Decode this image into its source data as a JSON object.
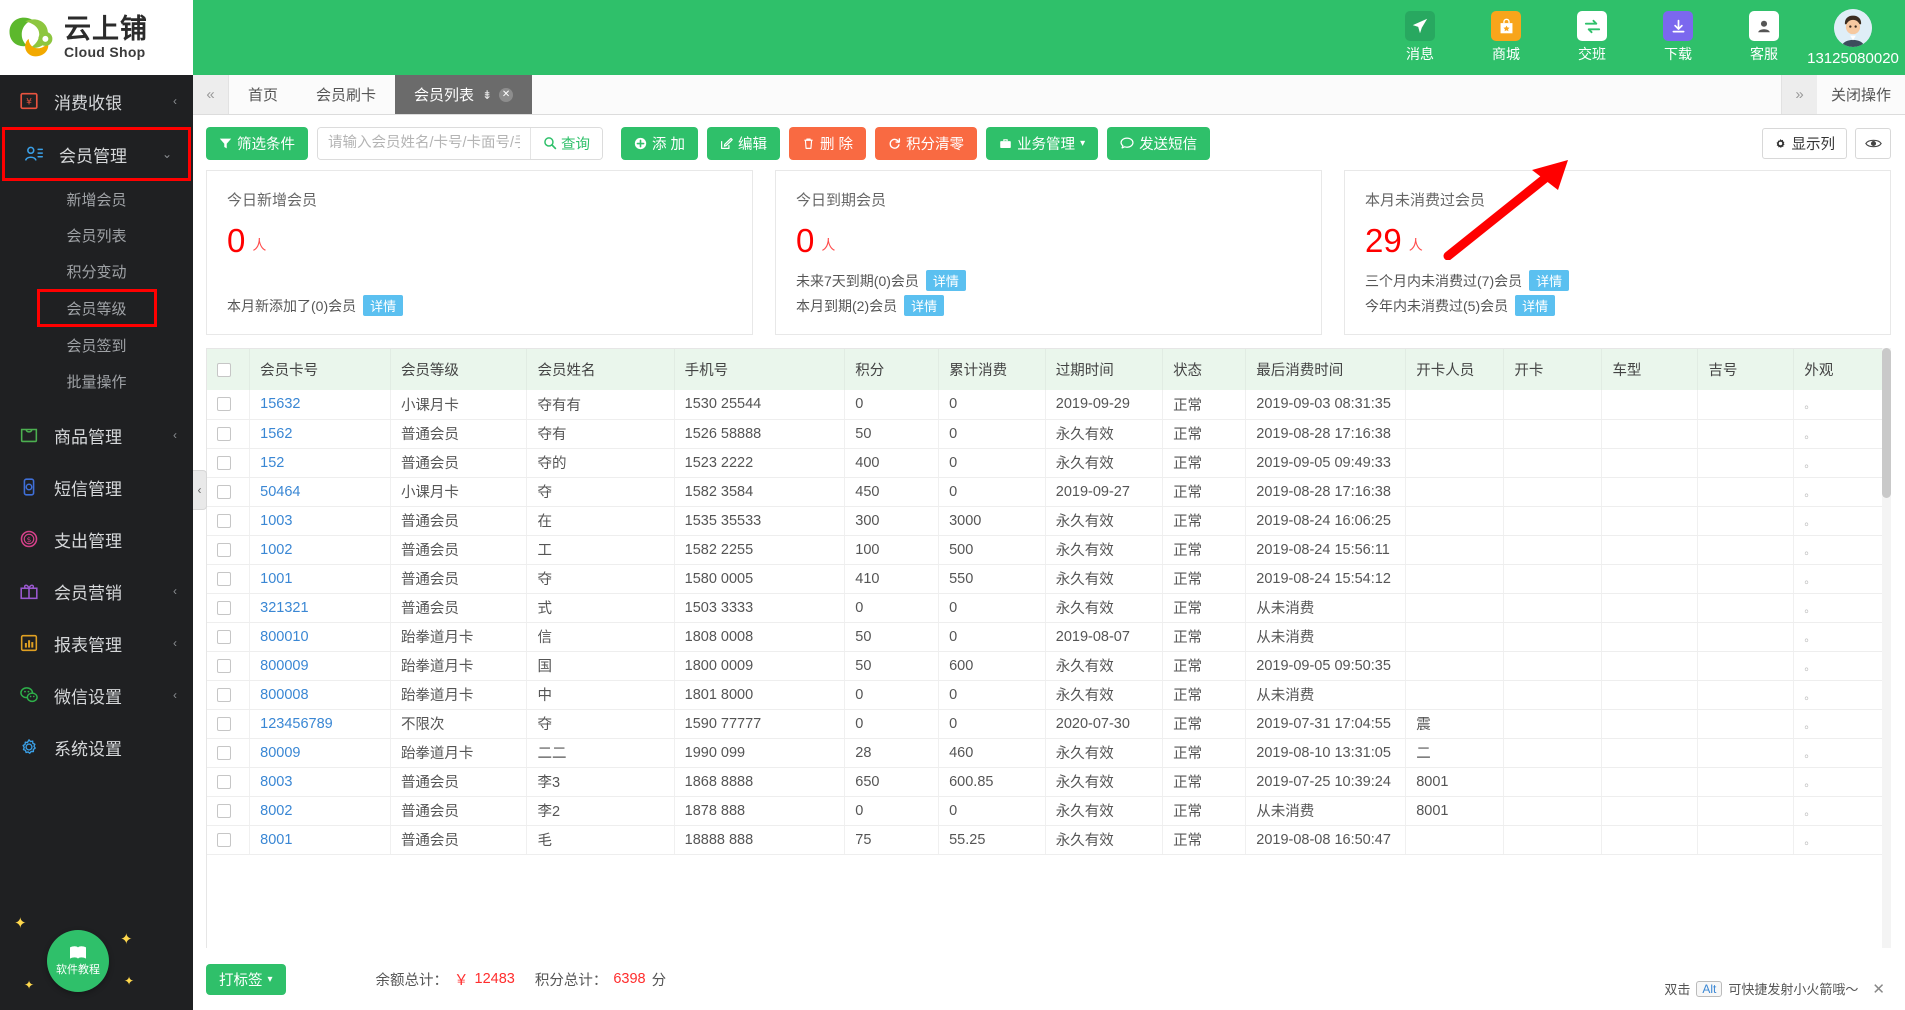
{
  "brand": {
    "cn": "云上铺",
    "en": "Cloud Shop"
  },
  "header": {
    "items": [
      {
        "label": "消息",
        "icon": "paper-plane-icon"
      },
      {
        "label": "商城",
        "icon": "shop-bag-icon"
      },
      {
        "label": "交班",
        "icon": "shift-exchange-icon"
      },
      {
        "label": "下载",
        "icon": "download-icon"
      },
      {
        "label": "客服",
        "icon": "customer-service-icon"
      }
    ],
    "account": "13125080020",
    "accent": "#2fc06a"
  },
  "sidebar": {
    "items": [
      {
        "label": "消费收银",
        "icon": "cashier-icon",
        "arrow": "‹",
        "boxed": false
      },
      {
        "label": "会员管理",
        "icon": "member-icon",
        "arrow": "⌄",
        "boxed": true
      }
    ],
    "sub_items": [
      {
        "label": "新增会员",
        "boxed": false
      },
      {
        "label": "会员列表",
        "boxed": false
      },
      {
        "label": "积分变动",
        "boxed": false
      },
      {
        "label": "会员等级",
        "boxed": true
      },
      {
        "label": "会员签到",
        "boxed": false
      },
      {
        "label": "批量操作",
        "boxed": false
      }
    ],
    "items_bottom": [
      {
        "label": "商品管理",
        "icon": "goods-icon",
        "arrow": "‹"
      },
      {
        "label": "短信管理",
        "icon": "sms-icon",
        "arrow": ""
      },
      {
        "label": "支出管理",
        "icon": "expense-icon",
        "arrow": ""
      },
      {
        "label": "会员营销",
        "icon": "gift-icon",
        "arrow": "‹"
      },
      {
        "label": "报表管理",
        "icon": "report-icon",
        "arrow": "‹"
      },
      {
        "label": "微信设置",
        "icon": "wechat-icon",
        "arrow": "‹"
      },
      {
        "label": "系统设置",
        "icon": "gear-icon",
        "arrow": ""
      }
    ]
  },
  "tabs": {
    "prev_icon": "«",
    "next_icon": "»",
    "items": [
      {
        "label": "首页",
        "active": false,
        "closable": false
      },
      {
        "label": "会员刷卡",
        "active": false,
        "closable": false
      },
      {
        "label": "会员列表",
        "active": true,
        "closable": true
      }
    ],
    "close_all": "关闭操作"
  },
  "toolbar": {
    "filter_label": "筛选条件",
    "search_placeholder": "请输入会员姓名/卡号/卡面号/手机号",
    "search_value": "",
    "query_label": "查询",
    "buttons": [
      {
        "label": "添 加",
        "style": "green",
        "icon": "plus-icon"
      },
      {
        "label": "编辑",
        "style": "green",
        "icon": "edit-icon"
      },
      {
        "label": "删 除",
        "style": "orange",
        "icon": "trash-icon"
      },
      {
        "label": "积分清零",
        "style": "orange",
        "icon": "refresh-icon"
      },
      {
        "label": "业务管理",
        "style": "green",
        "icon": "briefcase-icon",
        "caret": true
      },
      {
        "label": "发送短信",
        "style": "green",
        "icon": "chat-icon"
      }
    ],
    "show_columns_label": "显示列",
    "eye_icon": "eye-icon"
  },
  "cards": [
    {
      "title": "今日新增会员",
      "number": "0",
      "unit": "人",
      "lines": [
        {
          "text": "本月新添加了(0)会员",
          "badge": "详情"
        }
      ]
    },
    {
      "title": "今日到期会员",
      "number": "0",
      "unit": "人",
      "lines": [
        {
          "text": "未来7天到期(0)会员",
          "badge": "详情"
        },
        {
          "text": "本月到期(2)会员",
          "badge": "详情"
        }
      ]
    },
    {
      "title": "本月未消费过会员",
      "number": "29",
      "unit": "人",
      "lines": [
        {
          "text": "三个月内未消费过(7)会员",
          "badge": "详情"
        },
        {
          "text": "今年内未消费过(5)会员",
          "badge": "详情"
        }
      ]
    }
  ],
  "table": {
    "columns": [
      "会员卡号",
      "会员等级",
      "会员姓名",
      "手机号",
      "积分",
      "累计消费",
      "过期时间",
      "状态",
      "最后消费时间",
      "开卡人员",
      "开卡",
      "车型",
      "吉号",
      "外观"
    ],
    "rows": [
      {
        "card": "15632",
        "level": "小课月卡",
        "name": "夺有有",
        "phone": "1530   25544",
        "points": "0",
        "total": "0",
        "expire": "2019-09-29",
        "status": "正常",
        "last": "2019-09-03 08:31:35",
        "opener": "",
        "open": "",
        "carmodel": "",
        "lucky": "",
        "appearance": "。"
      },
      {
        "card": "1562",
        "level": "普通会员",
        "name": "夺有",
        "phone": "1526  58888",
        "points": "50",
        "total": "0",
        "expire": "永久有效",
        "status": "正常",
        "last": "2019-08-28 17:16:38",
        "opener": "",
        "open": "",
        "carmodel": "",
        "lucky": "",
        "appearance": "。"
      },
      {
        "card": "152",
        "level": "普通会员",
        "name": "夺的",
        "phone": "1523   2222",
        "points": "400",
        "total": "0",
        "expire": "永久有效",
        "status": "正常",
        "last": "2019-09-05 09:49:33",
        "opener": "",
        "open": "",
        "carmodel": "",
        "lucky": "",
        "appearance": "。"
      },
      {
        "card": "50464",
        "level": "小课月卡",
        "name": "夺",
        "phone": "1582  3584",
        "points": "450",
        "total": "0",
        "expire": "2019-09-27",
        "status": "正常",
        "last": "2019-08-28 17:16:38",
        "opener": "",
        "open": "",
        "carmodel": "",
        "lucky": "",
        "appearance": "。"
      },
      {
        "card": "1003",
        "level": "普通会员",
        "name": "在",
        "phone": "1535  35533",
        "points": "300",
        "total": "3000",
        "expire": "永久有效",
        "status": "正常",
        "last": "2019-08-24 16:06:25",
        "opener": "",
        "open": "",
        "carmodel": "",
        "lucky": "",
        "appearance": "。"
      },
      {
        "card": "1002",
        "level": "普通会员",
        "name": "工",
        "phone": "1582   2255",
        "points": "100",
        "total": "500",
        "expire": "永久有效",
        "status": "正常",
        "last": "2019-08-24 15:56:11",
        "opener": "",
        "open": "",
        "carmodel": "",
        "lucky": "",
        "appearance": "。"
      },
      {
        "card": "1001",
        "level": "普通会员",
        "name": "夺",
        "phone": "1580   0005",
        "points": "410",
        "total": "550",
        "expire": "永久有效",
        "status": "正常",
        "last": "2019-08-24 15:54:12",
        "opener": "",
        "open": "",
        "carmodel": "",
        "lucky": "",
        "appearance": "。"
      },
      {
        "card": "321321",
        "level": "普通会员",
        "name": "式",
        "phone": "1503  3333",
        "points": "0",
        "total": "0",
        "expire": "永久有效",
        "status": "正常",
        "last": "从未消费",
        "opener": "",
        "open": "",
        "carmodel": "",
        "lucky": "",
        "appearance": "。"
      },
      {
        "card": "800010",
        "level": "跆拳道月卡",
        "name": "信",
        "phone": "1808   0008",
        "points": "50",
        "total": "0",
        "expire": "2019-08-07",
        "status": "正常",
        "last": "从未消费",
        "opener": "",
        "open": "",
        "carmodel": "",
        "lucky": "",
        "appearance": "。"
      },
      {
        "card": "800009",
        "level": "跆拳道月卡",
        "name": "国",
        "phone": "1800   0009",
        "points": "50",
        "total": "600",
        "expire": "永久有效",
        "status": "正常",
        "last": "2019-09-05 09:50:35",
        "opener": "",
        "open": "",
        "carmodel": "",
        "lucky": "",
        "appearance": "。"
      },
      {
        "card": "800008",
        "level": "跆拳道月卡",
        "name": "中",
        "phone": "1801  8000",
        "points": "0",
        "total": "0",
        "expire": "永久有效",
        "status": "正常",
        "last": "从未消费",
        "opener": "",
        "open": "",
        "carmodel": "",
        "lucky": "",
        "appearance": "。"
      },
      {
        "card": "123456789",
        "level": "不限次",
        "name": "夺",
        "phone": "1590  77777",
        "points": "0",
        "total": "0",
        "expire": "2020-07-30",
        "status": "正常",
        "last": "2019-07-31 17:04:55",
        "opener": "震",
        "open": "",
        "carmodel": "",
        "lucky": "",
        "appearance": "。"
      },
      {
        "card": "80009",
        "level": "跆拳道月卡",
        "name": "二二",
        "phone": "1990   099",
        "points": "28",
        "total": "460",
        "expire": "永久有效",
        "status": "正常",
        "last": "2019-08-10 13:31:05",
        "opener": "二",
        "open": "",
        "carmodel": "",
        "lucky": "",
        "appearance": "。"
      },
      {
        "card": "8003",
        "level": "普通会员",
        "name": "李3",
        "phone": "1868  8888",
        "points": "650",
        "total": "600.85",
        "expire": "永久有效",
        "status": "正常",
        "last": "2019-07-25 10:39:24",
        "opener": "8001",
        "open": "",
        "carmodel": "",
        "lucky": "",
        "appearance": "。"
      },
      {
        "card": "8002",
        "level": "普通会员",
        "name": "李2",
        "phone": "1878   888",
        "points": "0",
        "total": "0",
        "expire": "永久有效",
        "status": "正常",
        "last": "从未消费",
        "opener": "8001",
        "open": "",
        "carmodel": "",
        "lucky": "",
        "appearance": "。"
      },
      {
        "card": "8001",
        "level": "普通会员",
        "name": "毛",
        "phone": "18888  888",
        "points": "75",
        "total": "55.25",
        "expire": "永久有效",
        "status": "正常",
        "last": "2019-08-08 16:50:47",
        "opener": "",
        "open": "",
        "carmodel": "",
        "lucky": "",
        "appearance": "。"
      }
    ]
  },
  "footer": {
    "tag_button": "打标签",
    "balance_label": "余额总计：",
    "balance_symbol": "￥",
    "balance_value": "12483",
    "points_label": "积分总计：",
    "points_value": "6398",
    "points_unit": "分"
  },
  "tip": {
    "prefix": "双击",
    "key": "Alt",
    "suffix": "可快捷发射小火箭哦～"
  },
  "help_float": {
    "label": "软件教程"
  }
}
